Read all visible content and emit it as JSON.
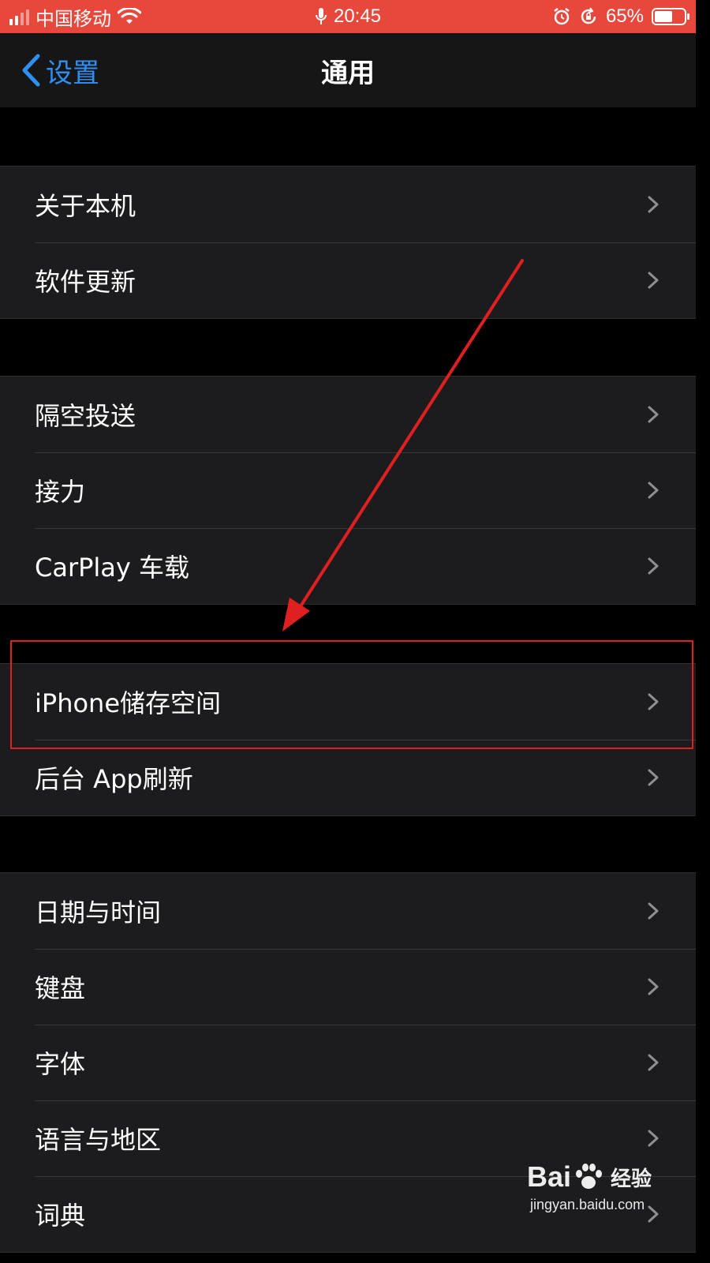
{
  "status_bar": {
    "carrier": "中国移动",
    "time": "20:45",
    "battery": "65%",
    "battery_level": 0.65,
    "icons": [
      "signal-icon",
      "wifi-icon",
      "mic-icon",
      "alarm-icon",
      "rotation-lock-icon",
      "battery-icon"
    ]
  },
  "nav": {
    "back_label": "设置",
    "title": "通用"
  },
  "groups": [
    {
      "items": [
        {
          "label": "关于本机"
        },
        {
          "label": "软件更新"
        }
      ]
    },
    {
      "items": [
        {
          "label": "隔空投送"
        },
        {
          "label": "接力"
        },
        {
          "label": "CarPlay 车载"
        }
      ]
    },
    {
      "items": [
        {
          "label": "iPhone储存空间"
        },
        {
          "label": "后台 App刷新"
        }
      ]
    },
    {
      "items": [
        {
          "label": "日期与时间"
        },
        {
          "label": "键盘"
        },
        {
          "label": "字体"
        },
        {
          "label": "语言与地区"
        },
        {
          "label": "词典"
        }
      ]
    }
  ],
  "annotation": {
    "highlight_color": "#e02020",
    "highlighted_item": "iPhone储存空间"
  },
  "watermark": {
    "brand": "Bai",
    "suffix": "经验",
    "url": "jingyan.baidu.com"
  },
  "colors": {
    "status_bar_bg": "#e8473c",
    "nav_bar_bg": "#161616",
    "page_bg": "#000000",
    "cell_bg": "#1c1c1e",
    "accent_blue": "#2f8ff5",
    "chevron": "#8e8e93"
  }
}
